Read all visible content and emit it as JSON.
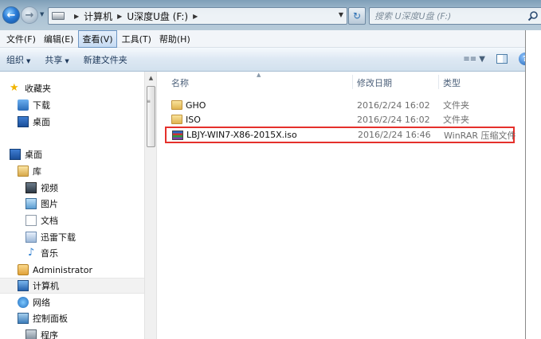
{
  "address_bar": {
    "crumbs": [
      "计算机",
      "U深度U盘 (F:)"
    ],
    "search_placeholder": "搜索 U深度U盘 (F:)"
  },
  "menu": {
    "items": [
      {
        "label": "文件(F)",
        "active": false
      },
      {
        "label": "编辑(E)",
        "active": false
      },
      {
        "label": "查看(V)",
        "active": true
      },
      {
        "label": "工具(T)",
        "active": false
      },
      {
        "label": "帮助(H)",
        "active": false
      }
    ]
  },
  "command_bar": {
    "organize": "组织",
    "share": "共享",
    "new_folder": "新建文件夹"
  },
  "nav_pane": {
    "items": [
      {
        "label": "收藏夹",
        "icon": "star-icon"
      },
      {
        "label": "下载",
        "icon": "download-folder-icon"
      },
      {
        "label": "桌面",
        "icon": "desktop-icon"
      },
      {
        "label": "桌面",
        "icon": "desktop-icon"
      },
      {
        "label": "库",
        "icon": "library-icon"
      },
      {
        "label": "视频",
        "icon": "video-icon"
      },
      {
        "label": "图片",
        "icon": "picture-icon"
      },
      {
        "label": "文档",
        "icon": "document-icon"
      },
      {
        "label": "迅雷下载",
        "icon": "library-folder-icon"
      },
      {
        "label": "音乐",
        "icon": "music-icon"
      },
      {
        "label": "Administrator",
        "icon": "user-folder-icon"
      },
      {
        "label": "计算机",
        "icon": "computer-icon"
      },
      {
        "label": "网络",
        "icon": "network-icon"
      },
      {
        "label": "控制面板",
        "icon": "control-panel-icon"
      },
      {
        "label": "程序",
        "icon": "programs-icon"
      }
    ]
  },
  "columns": {
    "name": "名称",
    "date": "修改日期",
    "type": "类型"
  },
  "files": [
    {
      "name": "GHO",
      "date": "2016/2/24 16:02",
      "type": "文件夹",
      "icon": "folder-icon"
    },
    {
      "name": "ISO",
      "date": "2016/2/24 16:02",
      "type": "文件夹",
      "icon": "folder-icon"
    },
    {
      "name": "LBJY-WIN7-X86-2015X.iso",
      "date": "2016/2/24 16:46",
      "type": "WinRAR 压缩文件",
      "icon": "winrar-archive-icon",
      "highlighted": true
    }
  ],
  "colors": {
    "highlight_border": "#e5302b",
    "address_strip": "#a9c1d3",
    "command_bar": "#dde8f3"
  }
}
